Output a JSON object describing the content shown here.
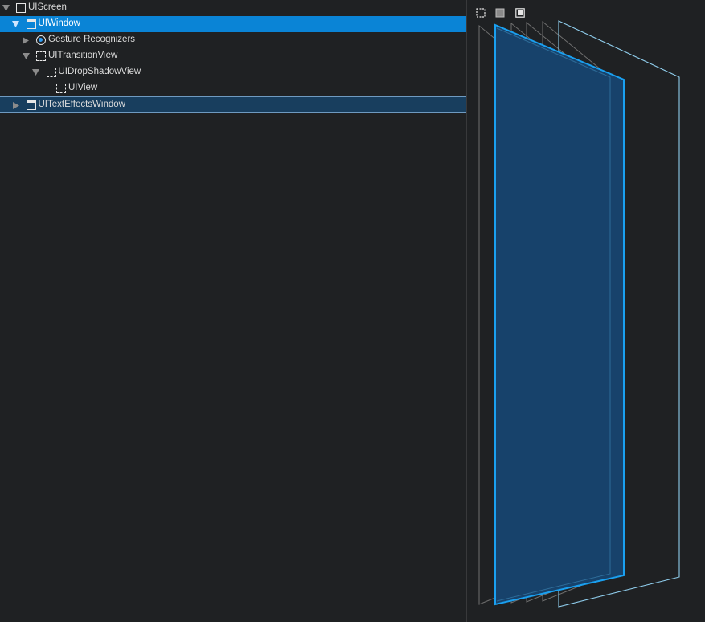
{
  "tree": {
    "rows": [
      {
        "label": "UIScreen",
        "depth": 0,
        "icon": "square-icon",
        "expanded": true,
        "state": "normal"
      },
      {
        "label": "UIWindow",
        "depth": 1,
        "icon": "window-icon",
        "expanded": true,
        "state": "selected"
      },
      {
        "label": "Gesture Recognizers",
        "depth": 2,
        "icon": "gesture-icon",
        "expanded": false,
        "state": "normal"
      },
      {
        "label": "UITransitionView",
        "depth": 2,
        "icon": "dashed-square-icon",
        "expanded": true,
        "state": "normal"
      },
      {
        "label": "UIDropShadowView",
        "depth": 3,
        "icon": "dashed-square-icon",
        "expanded": true,
        "state": "normal"
      },
      {
        "label": "UIView",
        "depth": 4,
        "icon": "dashed-square-icon",
        "expanded": null,
        "state": "normal"
      },
      {
        "label": "UITextEffectsWindow",
        "depth": 1,
        "icon": "window-icon",
        "expanded": false,
        "state": "secondary"
      }
    ]
  },
  "view_controls": [
    {
      "name": "wireframe-mode-button",
      "icon": "dashed-square-icon"
    },
    {
      "name": "contents-mode-button",
      "icon": "filled-square-icon"
    },
    {
      "name": "wireframe-contents-mode-button",
      "icon": "framed-square-icon"
    }
  ],
  "colors": {
    "background": "#1f2123",
    "selection": "#0a84d6",
    "secondary_selection": "#183e5e",
    "highlight_layer_fill": "#17426b",
    "highlight_layer_stroke": "#1aa0f0",
    "layer_stroke": "#6f6f6f",
    "outer_layer_stroke": "#8fcdec"
  }
}
